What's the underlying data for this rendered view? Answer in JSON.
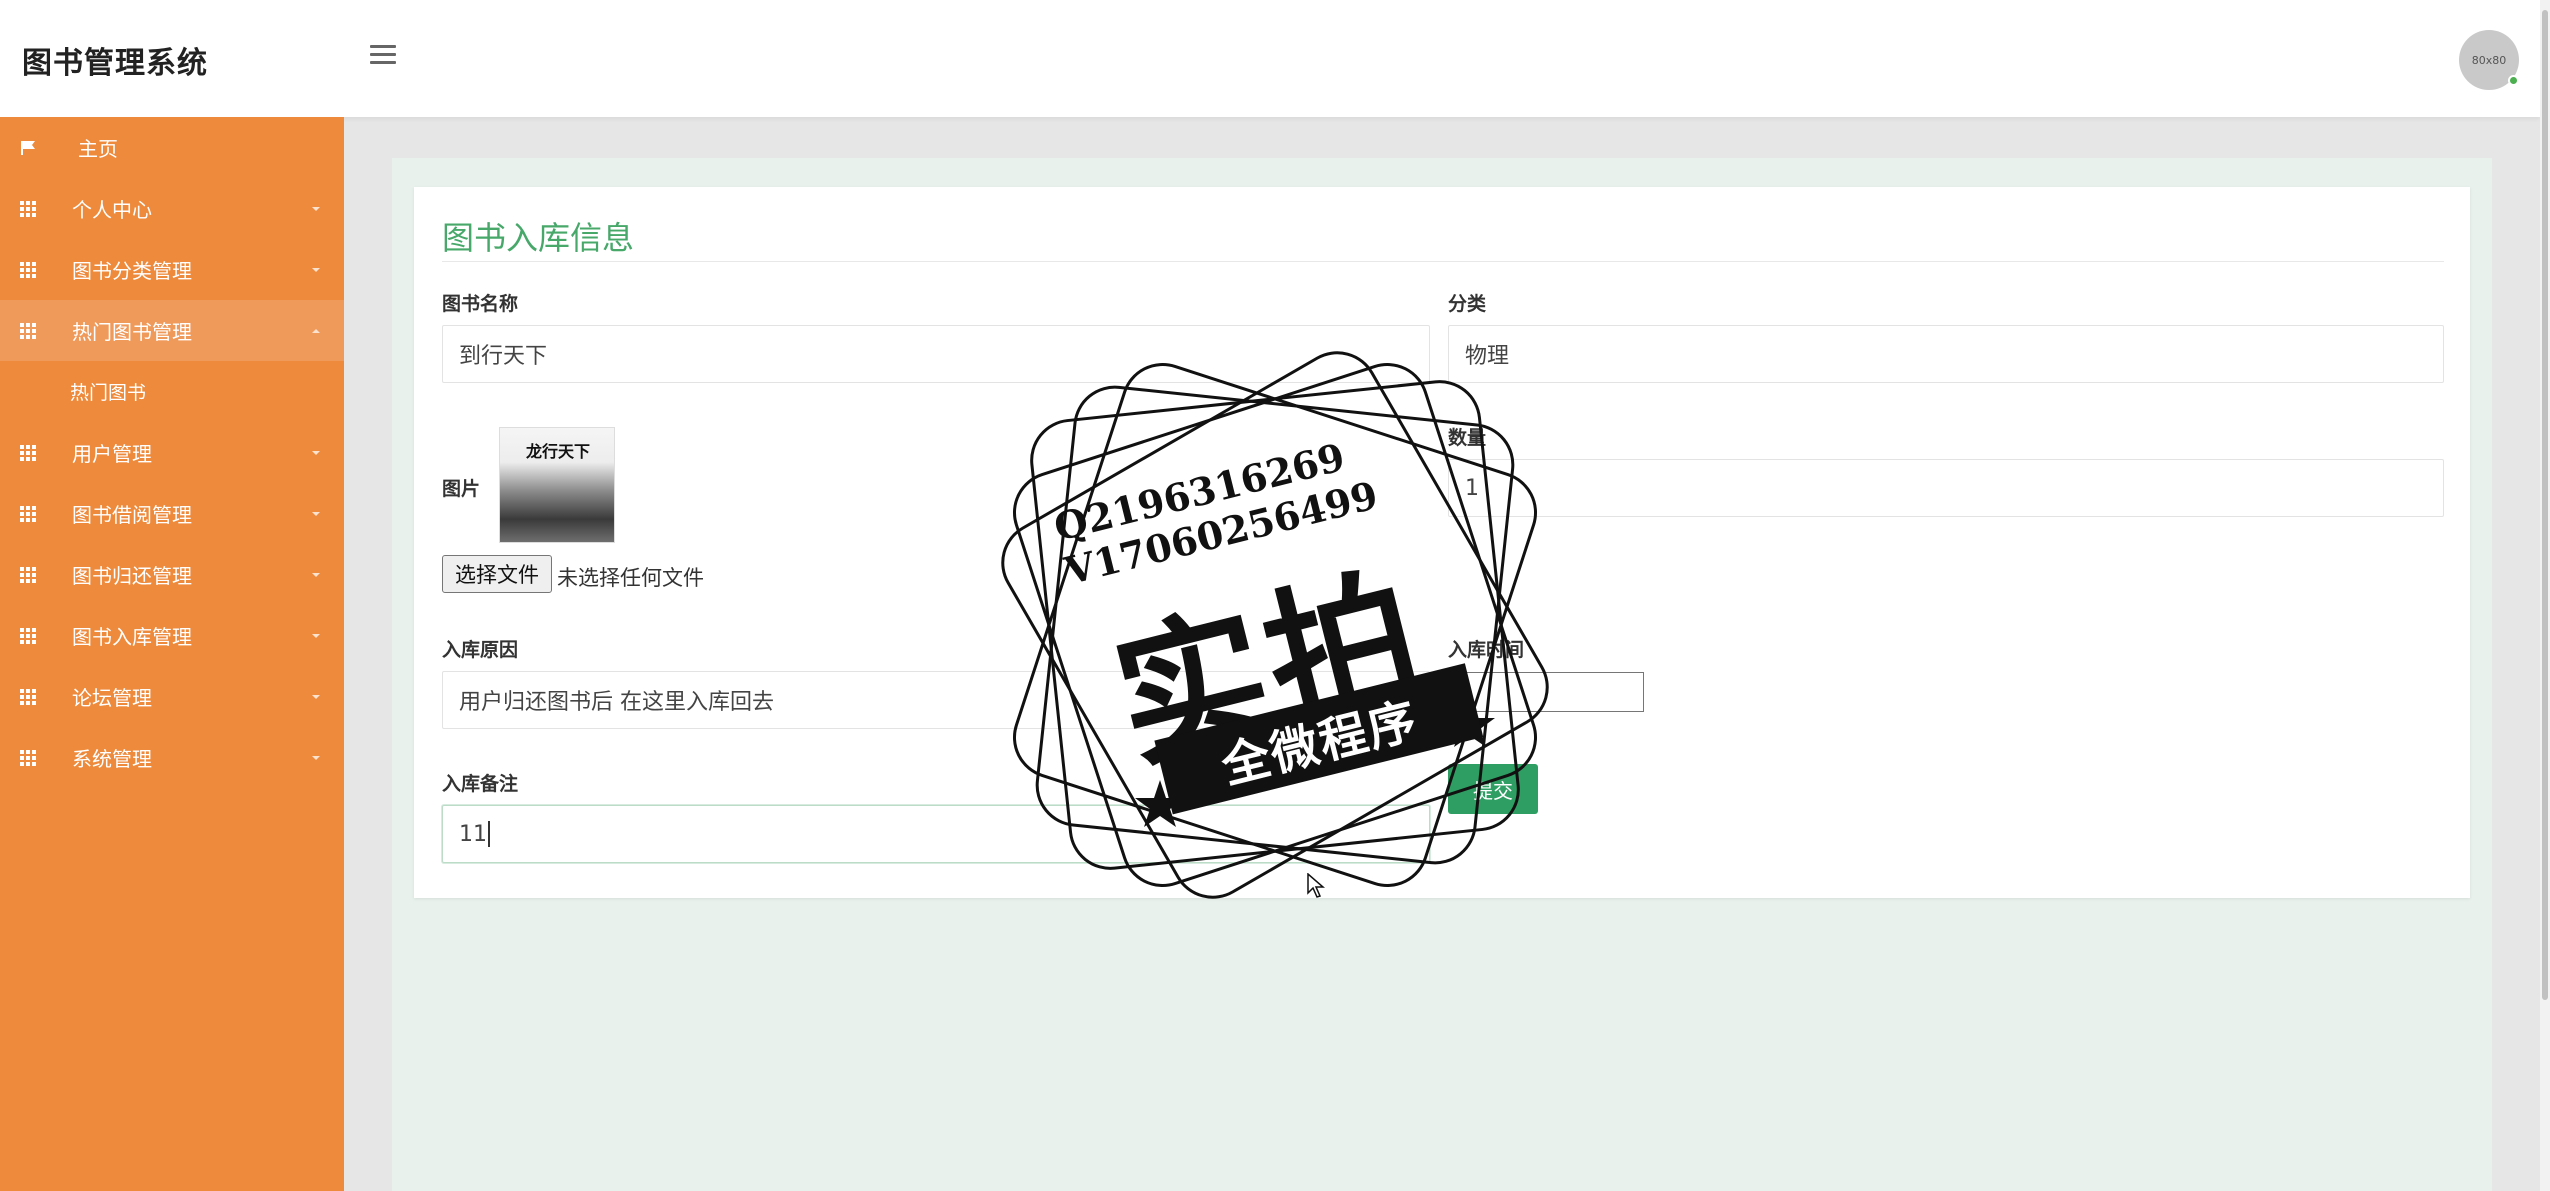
{
  "header": {
    "title": "图书管理系统",
    "avatar_text": "80x80"
  },
  "sidebar": {
    "items": [
      {
        "label": "主页",
        "icon": "flag-icon"
      },
      {
        "label": "个人中心",
        "icon": "grid-icon"
      },
      {
        "label": "图书分类管理",
        "icon": "grid-icon"
      },
      {
        "label": "热门图书管理",
        "icon": "grid-icon",
        "expanded": true
      },
      {
        "label": "热门图书",
        "icon": "",
        "submenu": true
      },
      {
        "label": "用户管理",
        "icon": "grid-icon"
      },
      {
        "label": "图书借阅管理",
        "icon": "grid-icon"
      },
      {
        "label": "图书归还管理",
        "icon": "grid-icon"
      },
      {
        "label": "图书入库管理",
        "icon": "grid-icon"
      },
      {
        "label": "论坛管理",
        "icon": "grid-icon"
      },
      {
        "label": "系统管理",
        "icon": "grid-icon"
      }
    ]
  },
  "form": {
    "title": "图书入库信息",
    "book_name_label": "图书名称",
    "book_name_value": "到行天下",
    "category_label": "分类",
    "category_value": "物理",
    "image_label": "图片",
    "image_title": "龙行天下",
    "quantity_label": "数量",
    "quantity_value": "1",
    "file_button": "选择文件",
    "file_status": "未选择任何文件",
    "reason_label": "入库原因",
    "reason_value": "用户归还图书后  在这里入库回去",
    "time_label": "入库时间",
    "remark_label": "入库备注",
    "remark_value": "11",
    "submit_label": "提交"
  },
  "watermark": {
    "line1": "Q2196316269",
    "line2": "V17060256499",
    "big": "实拍",
    "ribbon": "全微程序"
  },
  "colors": {
    "sidebar_bg": "#ed8a3c",
    "sidebar_active": "#ef995a",
    "title_green": "#47a86a",
    "submit_green": "#2f9e63",
    "content_bg": "#e8f1ec"
  }
}
